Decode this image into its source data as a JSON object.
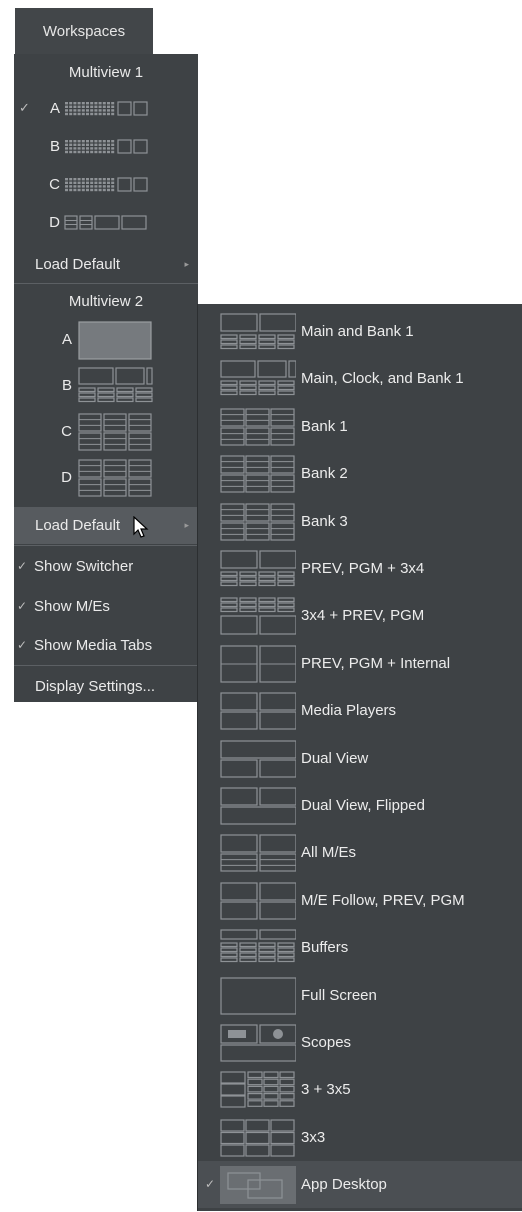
{
  "tab": {
    "label": "Workspaces"
  },
  "multiview1": {
    "header": "Multiview 1",
    "rows": [
      {
        "letter": "A",
        "checked": true,
        "layout": "dense-grid-two-boxes"
      },
      {
        "letter": "B",
        "checked": false,
        "layout": "dense-grid-two-boxes"
      },
      {
        "letter": "C",
        "checked": false,
        "layout": "dense-grid-two-boxes"
      },
      {
        "letter": "D",
        "checked": false,
        "layout": "bars-three-boxes"
      }
    ],
    "load_default": "Load Default",
    "check_mark": "✓",
    "arrow": "▸"
  },
  "multiview2": {
    "header": "Multiview 2",
    "rows": [
      {
        "letter": "A",
        "layout": "single-box"
      },
      {
        "letter": "B",
        "layout": "main-clock-bank"
      },
      {
        "letter": "C",
        "layout": "bank-grid"
      },
      {
        "letter": "D",
        "layout": "bank-grid"
      }
    ],
    "load_default": "Load Default"
  },
  "options": [
    {
      "label": "Show Switcher",
      "checked": true
    },
    {
      "label": "Show M/Es",
      "checked": true
    },
    {
      "label": "Show Media Tabs",
      "checked": true
    }
  ],
  "display_settings": "Display Settings...",
  "submenu": [
    {
      "label": "Main and Bank 1",
      "icon": "main-bank-icon"
    },
    {
      "label": "Main, Clock, and Bank 1",
      "icon": "main-clock-bank-icon"
    },
    {
      "label": "Bank 1",
      "icon": "bank-icon"
    },
    {
      "label": "Bank 2",
      "icon": "bank-icon"
    },
    {
      "label": "Bank 3",
      "icon": "bank-icon"
    },
    {
      "label": "PREV, PGM + 3x4",
      "icon": "prev-pgm-3x4-icon"
    },
    {
      "label": "3x4 + PREV, PGM",
      "icon": "3x4-prev-pgm-icon"
    },
    {
      "label": "PREV, PGM + Internal",
      "icon": "prev-pgm-internal-icon"
    },
    {
      "label": "Media Players",
      "icon": "media-players-icon"
    },
    {
      "label": "Dual View",
      "icon": "dual-view-icon"
    },
    {
      "label": "Dual View, Flipped",
      "icon": "dual-view-flipped-icon"
    },
    {
      "label": "All M/Es",
      "icon": "all-mes-icon"
    },
    {
      "label": "M/E Follow, PREV, PGM",
      "icon": "me-follow-icon"
    },
    {
      "label": "Buffers",
      "icon": "buffers-icon"
    },
    {
      "label": "Full Screen",
      "icon": "full-screen-icon"
    },
    {
      "label": "Scopes",
      "icon": "scopes-icon"
    },
    {
      "label": "3 + 3x5",
      "icon": "3-plus-3x5-icon"
    },
    {
      "label": "3x3",
      "icon": "3x3-icon"
    },
    {
      "label": "App Desktop",
      "icon": "app-desktop-icon",
      "checked": true
    }
  ]
}
